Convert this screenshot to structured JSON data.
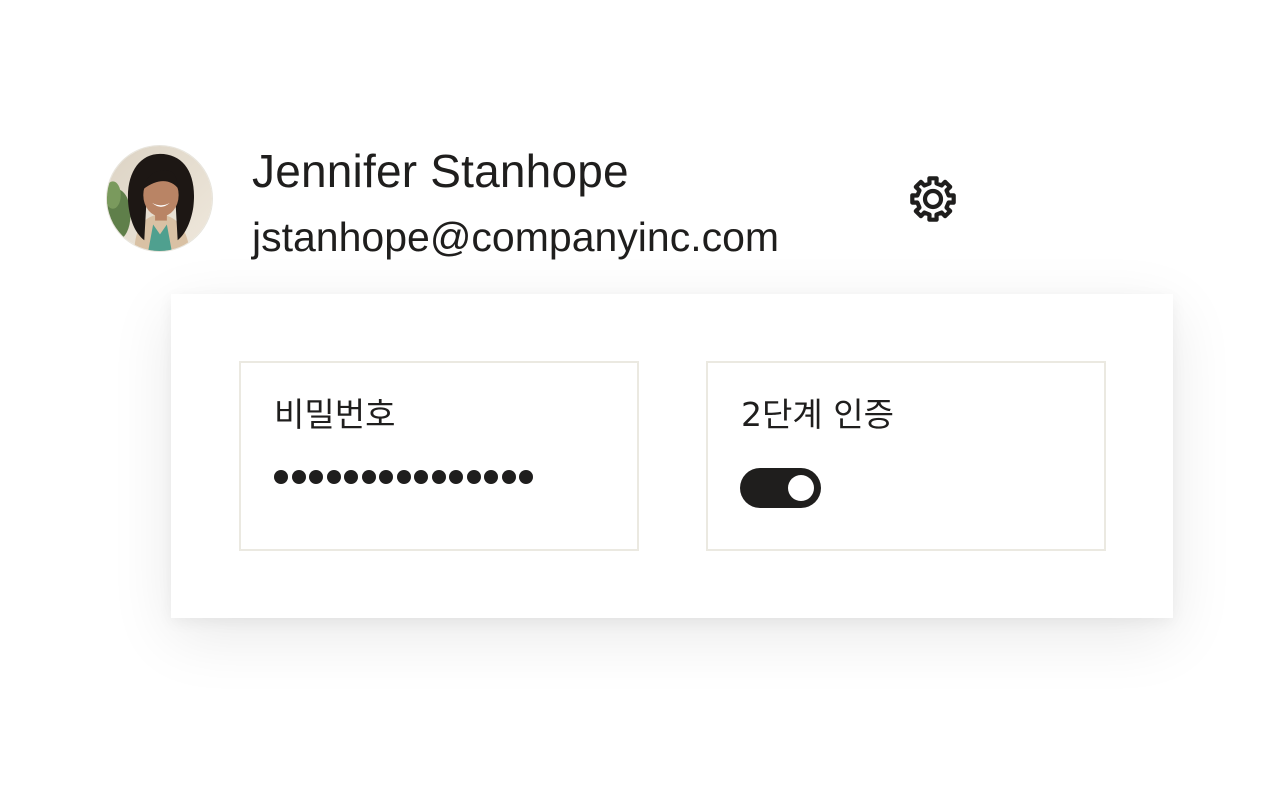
{
  "profile": {
    "name": "Jennifer Stanhope",
    "email": "jstanhope@companyinc.com",
    "avatar_icon": "user-photo",
    "settings_icon": "gear-icon"
  },
  "security": {
    "password": {
      "label": "비밀번호",
      "masked_length": 15
    },
    "two_factor": {
      "label": "2단계 인증",
      "enabled": true
    }
  },
  "colors": {
    "text": "#1f1e1d",
    "tile_border": "#ebe9e1",
    "toggle_on": "#1f1e1d"
  }
}
